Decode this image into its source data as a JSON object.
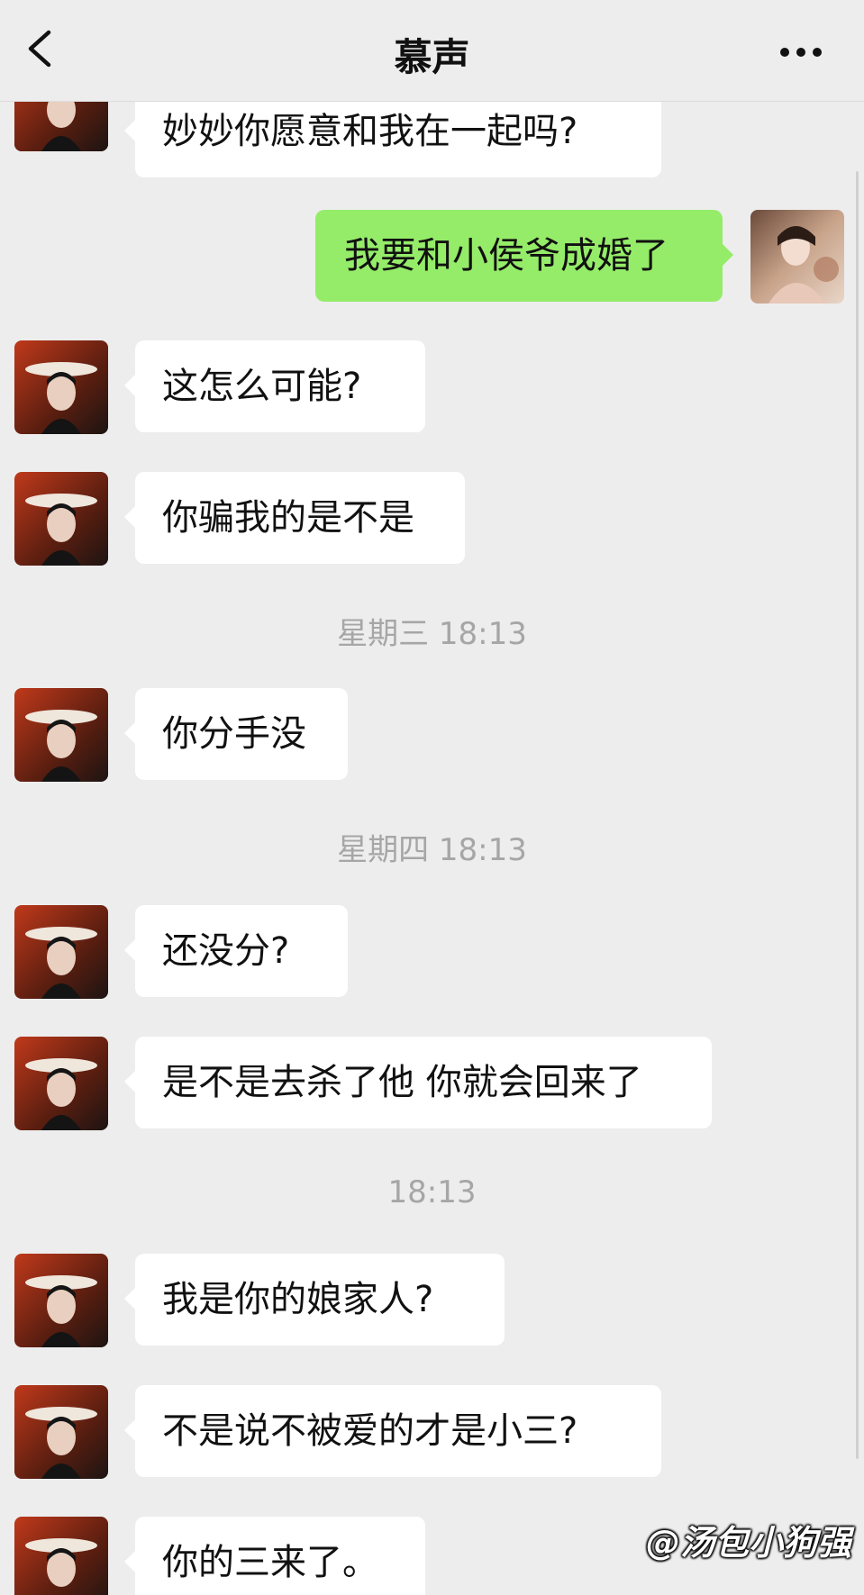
{
  "header": {
    "title": "慕声"
  },
  "messages": [
    {
      "side": "left",
      "text": "妙妙你愿意和我在一起吗?"
    },
    {
      "side": "right",
      "text": "我要和小侯爷成婚了"
    },
    {
      "side": "left",
      "text": "这怎么可能?"
    },
    {
      "side": "left",
      "text": "你骗我的是不是"
    },
    {
      "type": "time",
      "text": "星期三 18:13"
    },
    {
      "side": "left",
      "text": "你分手没"
    },
    {
      "type": "time",
      "text": "星期四 18:13"
    },
    {
      "side": "left",
      "text": "还没分?"
    },
    {
      "side": "left",
      "text": "是不是去杀了他 你就会回来了"
    },
    {
      "type": "time",
      "text": "18:13"
    },
    {
      "side": "left",
      "text": "我是你的娘家人?"
    },
    {
      "side": "left",
      "text": "不是说不被爱的才是小三?"
    },
    {
      "side": "left",
      "text": "你的三来了。"
    }
  ],
  "watermark": "@汤包小狗强",
  "colors": {
    "background": "#ededed",
    "incoming_bubble": "#ffffff",
    "outgoing_bubble": "#95ec69",
    "timestamp": "#a6a6a6"
  },
  "icons": {
    "back": "chevron-left-icon",
    "more": "more-dots-icon"
  }
}
